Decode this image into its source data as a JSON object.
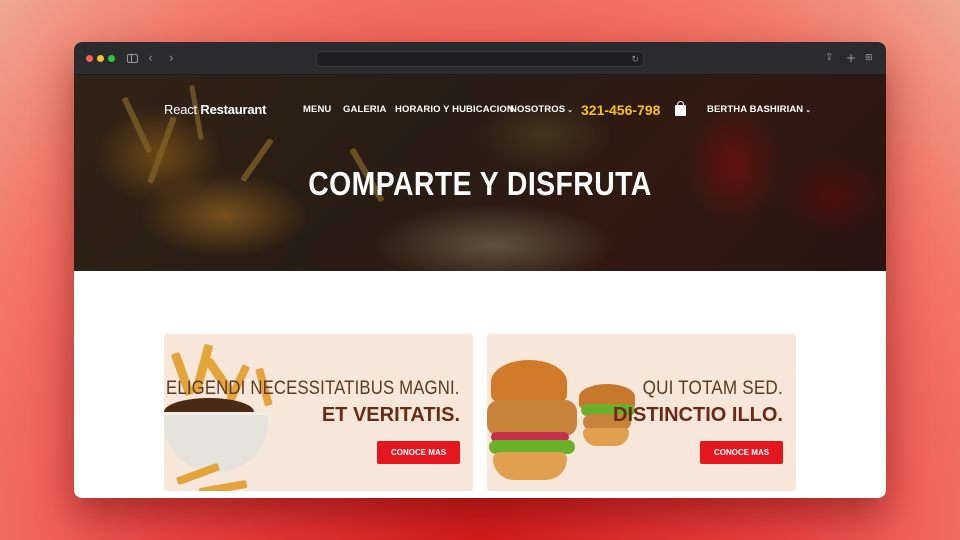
{
  "browser": {
    "back_icon": "chevron-left-icon",
    "forward_icon": "chevron-right-icon",
    "sidebar_icon": "sidebar-icon",
    "reload_icon": "reload-icon",
    "share_icon": "share-icon",
    "new_tab_icon": "plus-icon",
    "tabs_icon": "tab-grid-icon"
  },
  "nav": {
    "brand_light": "React ",
    "brand_bold": "Restaurant",
    "menu": "MENU",
    "galeria": "GALERIA",
    "horario": "HORARIO Y HUBICACION",
    "nosotros": "NOSOTROS",
    "phone": "321-456-798",
    "cart_icon": "shopping-bag-icon",
    "user": "BERTHA BASHIRIAN"
  },
  "hero": {
    "title": "COMPARTE Y DISFRUTA"
  },
  "promos": [
    {
      "line1": "ELIGENDI NECESSITATIBUS MAGNI.",
      "line2": "ET VERITATIS.",
      "button": "CONOCE MAS",
      "image": "poutine-fries-image"
    },
    {
      "line1": "QUI TOTAM SED.",
      "line2": "DISTINCTIO ILLO.",
      "button": "CONOCE MAS",
      "image": "chicken-burger-image"
    }
  ],
  "colors": {
    "accent_red": "#e4161e",
    "phone_yellow": "#f5c21b",
    "card_bg": "#f6e7da",
    "heading_brown": "#6a2a14"
  }
}
